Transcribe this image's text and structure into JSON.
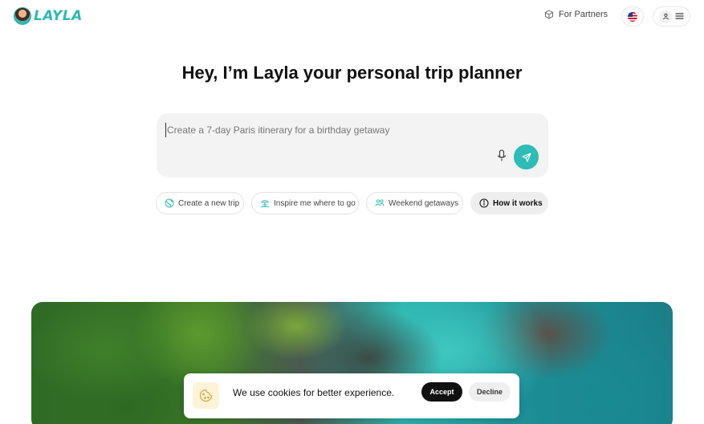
{
  "header": {
    "brand": "LAYLA",
    "partners_label": "For Partners",
    "language_flag": "us-flag-icon"
  },
  "main": {
    "title": "Hey, I’m Layla your personal trip planner",
    "prompt": {
      "placeholder": "Create a 7-day Paris itinerary for a birthday getaway",
      "value": ""
    },
    "chips": [
      {
        "label": "Create a new trip",
        "icon": "globe-icon"
      },
      {
        "label": "Inspire me where to go",
        "icon": "beach-icon"
      },
      {
        "label": "Weekend getaways",
        "icon": "people-icon"
      },
      {
        "label": "How it works",
        "icon": "info-icon"
      }
    ]
  },
  "cookie": {
    "text": "We use cookies for better experience.",
    "accept_label": "Accept",
    "decline_label": "Decline"
  },
  "colors": {
    "brand_teal": "#2dbcb6",
    "prompt_bg": "#f3f3f3",
    "accept_bg": "#111111"
  }
}
